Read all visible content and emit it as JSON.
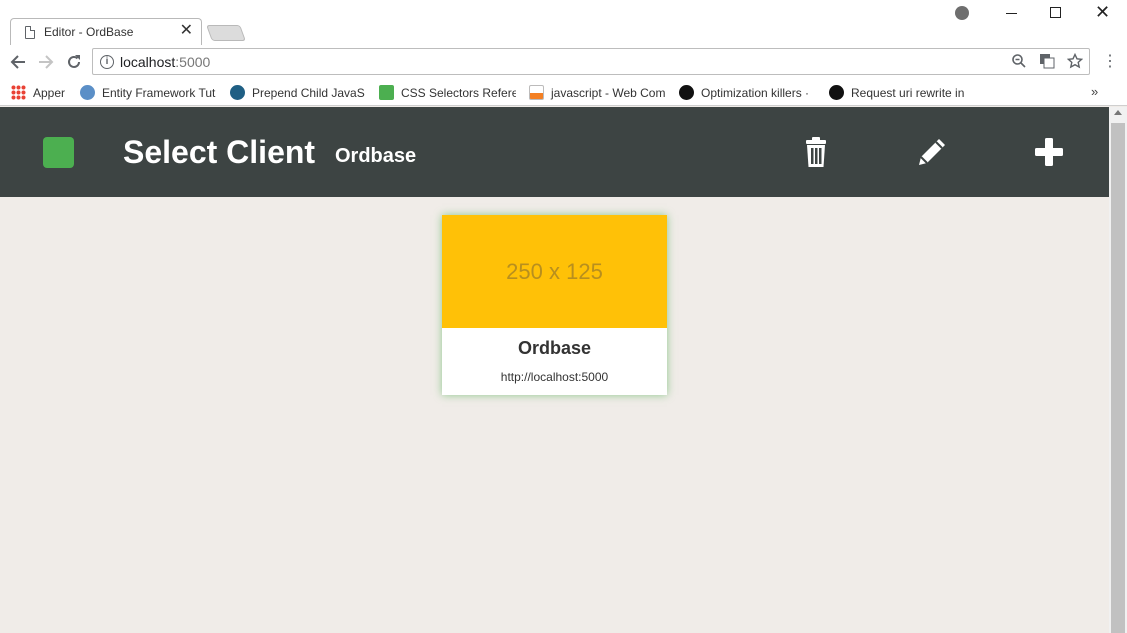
{
  "browser": {
    "tab_title": "Editor - OrdBase",
    "tab_close": "✕",
    "url_host": "localhost",
    "url_port": ":5000",
    "bookmarks": [
      {
        "label": "Apper",
        "icon": "apps-grid-icon",
        "color": "#e94235"
      },
      {
        "label": "Entity Framework Tut",
        "icon": "entity-framework-icon",
        "color": "#5b8fc7"
      },
      {
        "label": "Prepend Child JavaSc",
        "icon": "xbox-icon",
        "color": "#1f5f84"
      },
      {
        "label": "CSS Selectors Referer",
        "icon": "w3schools-icon",
        "color": "#4caf50"
      },
      {
        "label": "javascript - Web Com",
        "icon": "stackoverflow-icon",
        "color": "#f48024"
      },
      {
        "label": "Optimization killers · ",
        "icon": "github-icon",
        "color": "#111111"
      },
      {
        "label": "Request uri rewrite in",
        "icon": "github-icon",
        "color": "#111111"
      }
    ],
    "more": "»"
  },
  "app": {
    "title": "Select Client",
    "subtitle": "Ordbase",
    "status_color": "#4caf50",
    "header_color": "#3d4443"
  },
  "clients": [
    {
      "image_placeholder": "250 x 125",
      "name": "Ordbase",
      "url": "http://localhost:5000"
    }
  ]
}
